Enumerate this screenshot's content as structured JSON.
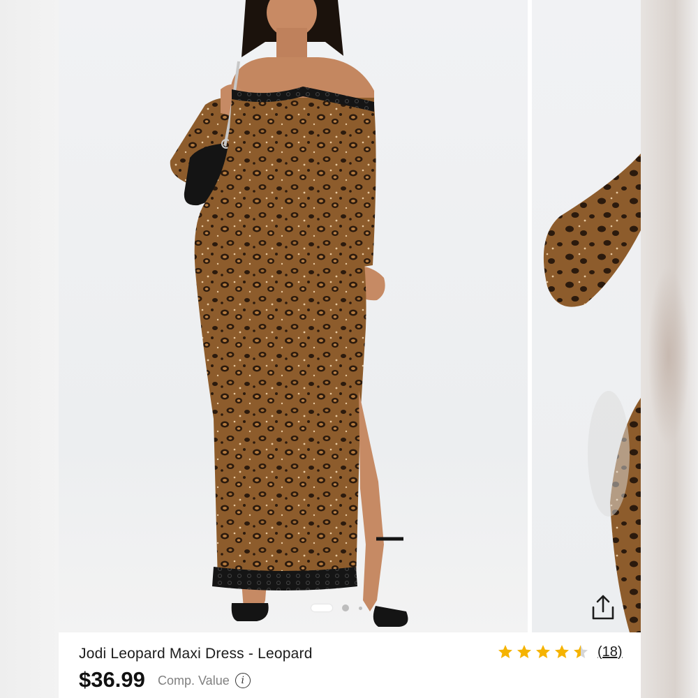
{
  "product": {
    "title": "Jodi Leopard Maxi Dress - Leopard",
    "price": "$36.99",
    "comp_value_label": "Comp. Value",
    "rating": 4.5,
    "review_count": "(18)"
  },
  "carousel": {
    "total_slides": 3,
    "active_slide": 1
  },
  "icons": {
    "share": "share-icon",
    "info": "info-icon",
    "star": "star-icon"
  },
  "colors": {
    "star": "#f5b301",
    "star_empty": "#d6d6d6",
    "text": "#1c1c1c",
    "muted": "#808080",
    "leopard_base": "#8a5a2b"
  }
}
